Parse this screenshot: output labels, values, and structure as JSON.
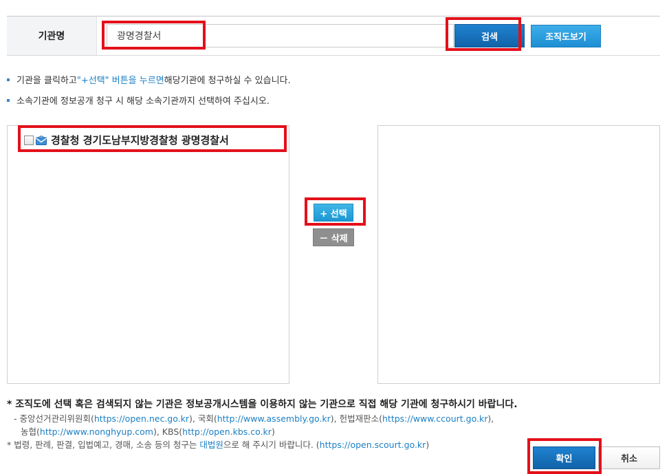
{
  "search": {
    "label": "기관명",
    "value": "광명경찰서",
    "search_button": "검색",
    "org_chart_button": "조직도보기"
  },
  "notices": [
    {
      "before": "기관을 클릭하고 ",
      "link": "\"+선택\" 버튼을 누르면",
      "after": " 해당기관에 청구하실 수 있습니다."
    },
    {
      "text": "소속기관에 정보공개 청구 시 해당 소속기관까지 선택하여 주십시오."
    }
  ],
  "tree": {
    "items": [
      {
        "label": "경찰청 경기도남부지방경찰청 광명경찰서",
        "icon": "mail-icon"
      }
    ]
  },
  "transfer": {
    "add_label": "+ 선택",
    "remove_label": "－ 삭제"
  },
  "footer": {
    "note1": "* 조직도에 선택 혹은 검색되지 않는 기관은 정보공개시스템을 이용하지 않는 기관으로 직접 해당 기관에 청구하시기 바랍니다.",
    "line2": {
      "p1": "- 중앙선거관리위원회(",
      "url1": "https://open.nec.go.kr",
      "p2": "), 국회(",
      "url2": "http://www.assembly.go.kr",
      "p3": "), 헌법재판소(",
      "url3": "https://www.ccourt.go.kr",
      "p4": "),"
    },
    "line3": {
      "p1": "농협(",
      "url1": "http://www.nonghyup.com",
      "p2": "), KBS(",
      "url2": "http://open.kbs.co.kr",
      "p3": ")"
    },
    "line4": {
      "p1": "* 법령, 판례, 판결, 입법예고, 경매, 소송 등의 청구는 ",
      "link": "대법원",
      "p2": "으로 해 주시기 바랍니다. (",
      "url": "https://open.scourt.go.kr",
      "p3": ")"
    }
  },
  "actions": {
    "confirm": "확인",
    "cancel": "취소"
  },
  "colors": {
    "highlight": "#e3101a",
    "primary": "#1163a8",
    "secondary": "#1c8fd3",
    "link": "#1a7fc4"
  }
}
